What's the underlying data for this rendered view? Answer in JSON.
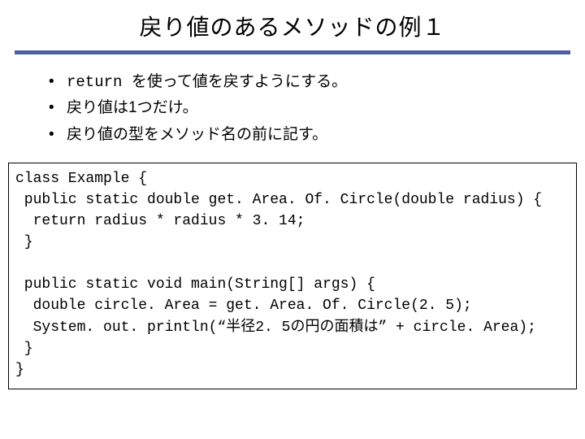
{
  "title": "戻り値のあるメソッドの例１",
  "bullets": [
    {
      "prefix": "return ",
      "rest": "を使って値を戻すようにする。"
    },
    {
      "prefix": "",
      "rest": "戻り値は1つだけ。"
    },
    {
      "prefix": "",
      "rest": "戻り値の型をメソッド名の前に記す。"
    }
  ],
  "code": {
    "l1": "class Example {",
    "l2": " public static double get. Area. Of. Circle(double radius) {",
    "l3": "  return radius * radius * 3. 14;",
    "l4": " }",
    "l5": "",
    "l6": " public static void main(String[] args) {",
    "l7": "  double circle. Area = get. Area. Of. Circle(2. 5);",
    "l8": "  System. out. println(“半径2. 5の円の面積は” + circle. Area);",
    "l9": " }",
    "l10": "}"
  }
}
